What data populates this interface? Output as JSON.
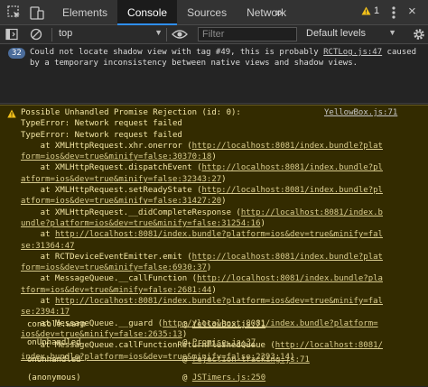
{
  "tabbar": {
    "tabs": [
      {
        "label": "Elements",
        "active": false
      },
      {
        "label": "Console",
        "active": true
      },
      {
        "label": "Sources",
        "active": false
      },
      {
        "label": "Network",
        "active": false
      }
    ],
    "more": "»",
    "warning_count": "1",
    "close": "×"
  },
  "toolbar": {
    "context": "top",
    "filter_placeholder": "Filter",
    "levels": "Default levels",
    "caret": "▼"
  },
  "info_message": {
    "count": "32",
    "text_before": "Could not locate shadow view with tag #49, this is probably ",
    "link": "RCTLog.js:47",
    "text_after": " caused by a temporary inconsistency between native views and shadow views."
  },
  "warning_message": {
    "source": "YellowBox.js:71",
    "lines": [
      {
        "pre": "Possible Unhandled Promise Rejection (id: 0):",
        "link": "",
        "post": ""
      },
      {
        "pre": "TypeError: Network request failed",
        "link": "",
        "post": ""
      },
      {
        "pre": "TypeError: Network request failed",
        "link": "",
        "post": ""
      },
      {
        "pre": "    at XMLHttpRequest.xhr.onerror (",
        "link": "http://localhost:8081/index.bundle?plat",
        "post": ""
      },
      {
        "pre": "",
        "link": "form=ios&dev=true&minify=false:30370:18",
        "post": ")"
      },
      {
        "pre": "    at XMLHttpRequest.dispatchEvent (",
        "link": "http://localhost:8081/index.bundle?pl",
        "post": ""
      },
      {
        "pre": "",
        "link": "atform=ios&dev=true&minify=false:32343:27",
        "post": ")"
      },
      {
        "pre": "    at XMLHttpRequest.setReadyState (",
        "link": "http://localhost:8081/index.bundle?pl",
        "post": ""
      },
      {
        "pre": "",
        "link": "atform=ios&dev=true&minify=false:31427:20",
        "post": ")"
      },
      {
        "pre": "    at XMLHttpRequest.__didCompleteResponse (",
        "link": "http://localhost:8081/index.b",
        "post": ""
      },
      {
        "pre": "",
        "link": "undle?platform=ios&dev=true&minify=false:31254:16",
        "post": ")"
      },
      {
        "pre": "    at ",
        "link": "http://localhost:8081/index.bundle?platform=ios&dev=true&minify=fal",
        "post": ""
      },
      {
        "pre": "",
        "link": "se:31364:47",
        "post": ""
      },
      {
        "pre": "    at RCTDeviceEventEmitter.emit (",
        "link": "http://localhost:8081/index.bundle?plat",
        "post": ""
      },
      {
        "pre": "",
        "link": "form=ios&dev=true&minify=false:6930:37",
        "post": ")"
      },
      {
        "pre": "    at MessageQueue.__callFunction (",
        "link": "http://localhost:8081/index.bundle?pla",
        "post": ""
      },
      {
        "pre": "",
        "link": "tform=ios&dev=true&minify=false:2681:44",
        "post": ")"
      },
      {
        "pre": "    at ",
        "link": "http://localhost:8081/index.bundle?platform=ios&dev=true&minify=fal",
        "post": ""
      },
      {
        "pre": "",
        "link": "se:2394:17",
        "post": ""
      },
      {
        "pre": "    at MessageQueue.__guard (",
        "link": "http://localhost:8081/index.bundle?platform=",
        "post": ""
      },
      {
        "pre": "",
        "link": "ios&dev=true&minify=false:2635:13",
        "post": ")"
      },
      {
        "pre": "    at MessageQueue.callFunctionReturnFlushedQueue (",
        "link": "http://localhost:8081/",
        "post": ""
      },
      {
        "pre": "",
        "link": "index.bundle?platform=ios&dev=true&minify=false:2393:14",
        "post": ")"
      }
    ],
    "trace": [
      {
        "name": "console.warn",
        "at": "@ ",
        "link": "YellowBox.js:71"
      },
      {
        "name": "onUnhandled",
        "at": "@ ",
        "link": "Promise.js:37"
      },
      {
        "name": "onUnhandled",
        "at": "@ ",
        "link": "rejection-tracking.js:71"
      },
      {
        "name": "(anonymous)",
        "at": "@ ",
        "link": "JSTimers.js:250"
      }
    ]
  }
}
